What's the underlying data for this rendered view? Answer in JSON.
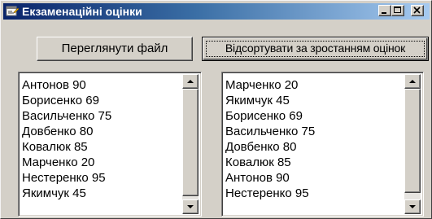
{
  "window": {
    "title": "Екзаменаційні  оцінки",
    "icon": "form-icon",
    "caption_buttons": [
      "minimize-icon",
      "maximize-icon",
      "close-icon"
    ]
  },
  "buttons": {
    "view_file": "Переглянути файл",
    "sort_ascending": "Відсортувати за зростанням оцінок"
  },
  "lists": {
    "original": [
      "Антонов 90",
      "Борисенко 69",
      "Васильченко 75",
      "Довбенко 80",
      "Ковалюк 85",
      "Марченко 20",
      "Нестеренко 95",
      "Якимчук 45"
    ],
    "sorted": [
      "Марченко 20",
      "Якимчук 45",
      "Борисенко 69",
      "Васильченко 75",
      "Довбенко 80",
      "Ковалюк 85",
      "Антонов 90",
      "Нестеренко 95"
    ]
  }
}
